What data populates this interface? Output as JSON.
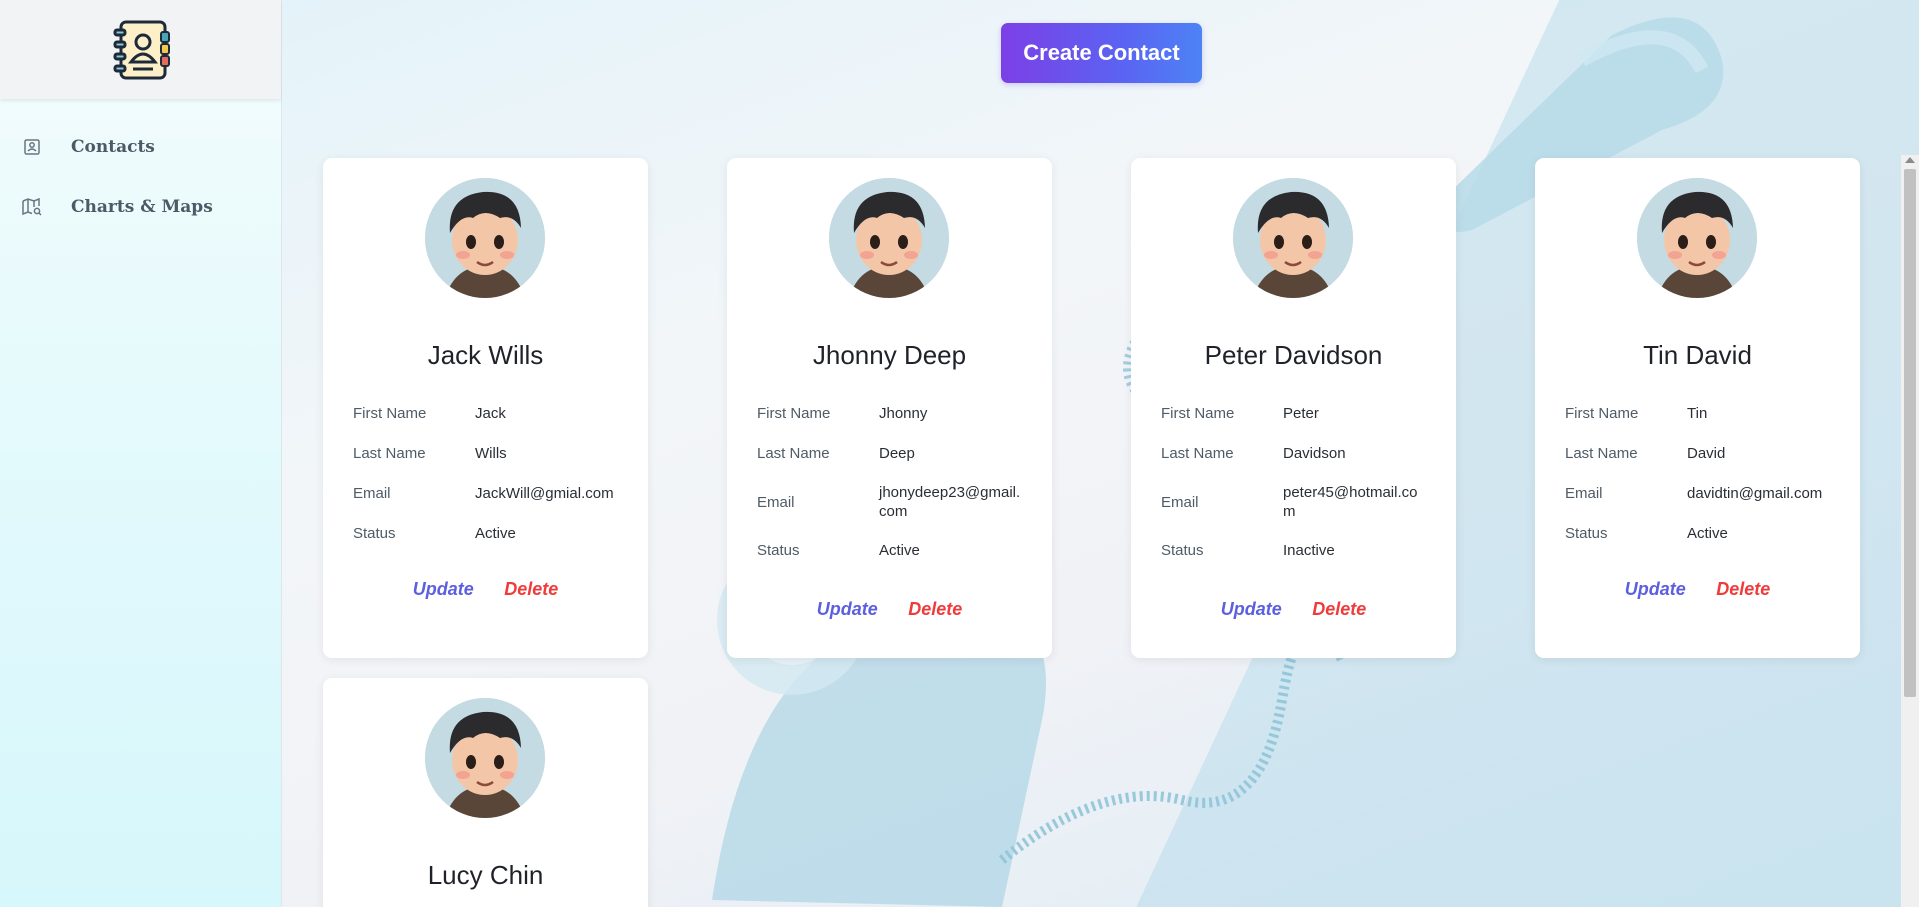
{
  "sidebar": {
    "items": [
      {
        "label": "Contacts",
        "icon": "address-book-icon"
      },
      {
        "label": "Charts & Maps",
        "icon": "map-search-icon"
      }
    ]
  },
  "header": {
    "create_label": "Create Contact"
  },
  "labels": {
    "first": "First Name",
    "last": "Last Name",
    "email": "Email",
    "status": "Status",
    "update": "Update",
    "delete": "Delete"
  },
  "contacts": [
    {
      "name": "Jack Wills",
      "first": "Jack",
      "last": "Wills",
      "email": "JackWill@gmial.com",
      "status": "Active"
    },
    {
      "name": "Jhonny Deep",
      "first": "Jhonny",
      "last": "Deep",
      "email": "jhonydeep23@gmail.com",
      "status": "Active"
    },
    {
      "name": "Peter Davidson",
      "first": "Peter",
      "last": "Davidson",
      "email": "peter45@hotmail.com",
      "status": "Inactive"
    },
    {
      "name": "Tin David",
      "first": "Tin",
      "last": "David",
      "email": "davidtin@gmail.com",
      "status": "Active"
    },
    {
      "name": "Lucy Chin"
    }
  ],
  "colors": {
    "accent_start": "#7c3fe6",
    "accent_end": "#4d82f5",
    "update": "#5b5fe0",
    "delete": "#ef3b3b"
  }
}
